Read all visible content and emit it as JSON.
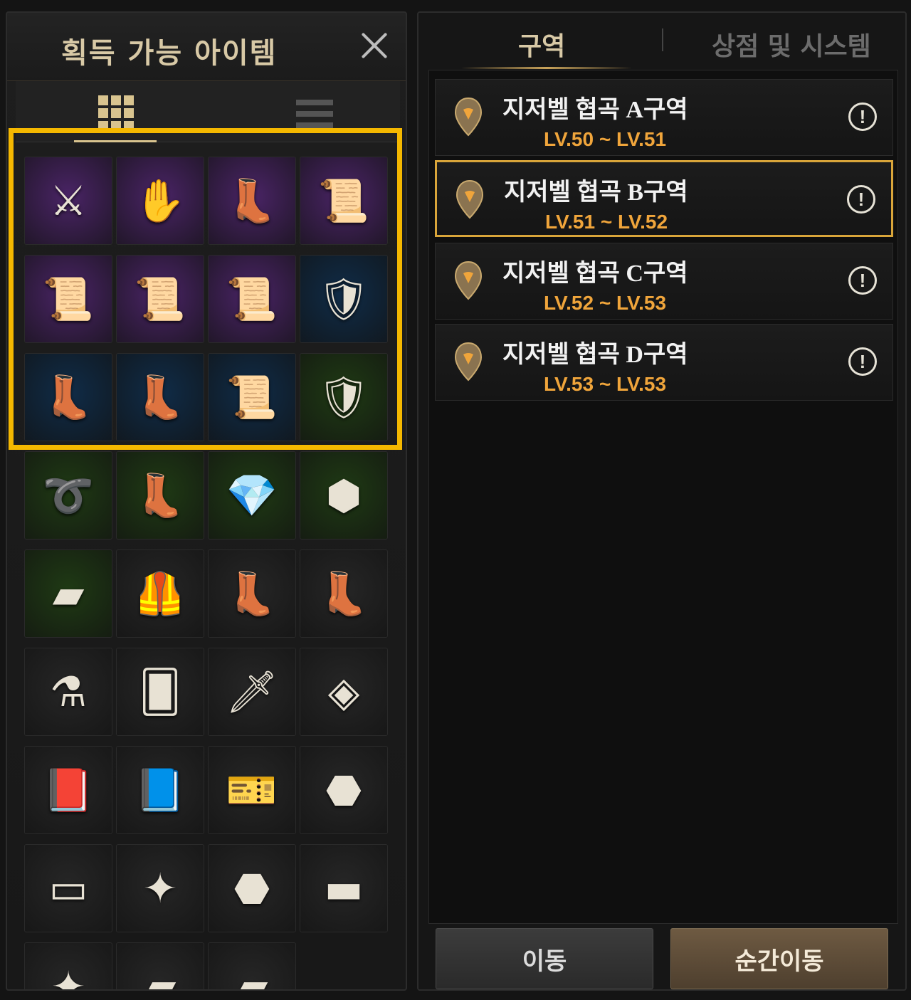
{
  "left_panel": {
    "title": "획득 가능 아이템",
    "close_icon": "close-icon",
    "view_modes": [
      "grid-view-icon",
      "list-view-icon"
    ],
    "items": [
      {
        "name": "crossbow",
        "glyph": "⚔",
        "bg": "#4a2466"
      },
      {
        "name": "leather-gloves",
        "glyph": "✋",
        "bg": "#4a2466"
      },
      {
        "name": "steel-boots",
        "glyph": "👢",
        "bg": "#4a2466"
      },
      {
        "name": "recipe-scroll",
        "glyph": "📜",
        "bg": "#4a2466"
      },
      {
        "name": "sword-blueprint",
        "glyph": "📜",
        "bg": "#4a2466"
      },
      {
        "name": "helmet-blueprint",
        "glyph": "📜",
        "bg": "#4a2466"
      },
      {
        "name": "necklace-blueprint",
        "glyph": "📜",
        "bg": "#4a2466"
      },
      {
        "name": "plate-armor",
        "glyph": "🛡",
        "bg": "#102c48"
      },
      {
        "name": "leather-boots",
        "glyph": "👢",
        "bg": "#102c48"
      },
      {
        "name": "blue-boots",
        "glyph": "👢",
        "bg": "#102c48"
      },
      {
        "name": "recipe-scroll-2",
        "glyph": "📜",
        "bg": "#102c48"
      },
      {
        "name": "dark-armor",
        "glyph": "🛡",
        "bg": "#1f3a14"
      },
      {
        "name": "belt",
        "glyph": "➰",
        "bg": "#1f3a14"
      },
      {
        "name": "metal-greaves",
        "glyph": "👢",
        "bg": "#1f3a14"
      },
      {
        "name": "crystal",
        "glyph": "💎",
        "bg": "#1f3a14"
      },
      {
        "name": "dice-stone",
        "glyph": "⬢",
        "bg": "#1f3a14"
      },
      {
        "name": "ingots",
        "glyph": "▰",
        "bg": "#1f3a14"
      },
      {
        "name": "leather-vest",
        "glyph": "🦺",
        "bg": "#262626"
      },
      {
        "name": "green-boots",
        "glyph": "👢",
        "bg": "#262626"
      },
      {
        "name": "brown-boots",
        "glyph": "👢",
        "bg": "#262626"
      },
      {
        "name": "red-potion",
        "glyph": "⚗",
        "bg": "#262626"
      },
      {
        "name": "tarot-card",
        "glyph": "🂠",
        "bg": "#262626"
      },
      {
        "name": "sword-rune",
        "glyph": "🗡",
        "bg": "#262626"
      },
      {
        "name": "necklace-rune",
        "glyph": "◈",
        "bg": "#262626"
      },
      {
        "name": "red-book",
        "glyph": "📕",
        "bg": "#262626"
      },
      {
        "name": "purple-book",
        "glyph": "📘",
        "bg": "#262626"
      },
      {
        "name": "ticket",
        "glyph": "🎫",
        "bg": "#262626"
      },
      {
        "name": "ore",
        "glyph": "⬣",
        "bg": "#262626"
      },
      {
        "name": "wood-log",
        "glyph": "▭",
        "bg": "#262626"
      },
      {
        "name": "silver-ore-chunk",
        "glyph": "✦",
        "bg": "#262626"
      },
      {
        "name": "iron-ore",
        "glyph": "⬣",
        "bg": "#262626"
      },
      {
        "name": "plank",
        "glyph": "▬",
        "bg": "#262626"
      },
      {
        "name": "green-ore",
        "glyph": "✦",
        "bg": "#262626"
      },
      {
        "name": "copper-ingot",
        "glyph": "▰",
        "bg": "#262626"
      },
      {
        "name": "silver-ingot",
        "glyph": "▰",
        "bg": "#262626"
      }
    ]
  },
  "right_panel": {
    "tabs": [
      {
        "label": "구역",
        "active": true
      },
      {
        "label": "상점 및 시스템",
        "active": false
      }
    ],
    "zones": [
      {
        "name": "지저벨 협곡 A구역",
        "level": "LV.50 ~ LV.51",
        "selected": false
      },
      {
        "name": "지저벨 협곡 B구역",
        "level": "LV.51 ~ LV.52",
        "selected": true
      },
      {
        "name": "지저벨 협곡 C구역",
        "level": "LV.52 ~ LV.53",
        "selected": false
      },
      {
        "name": "지저벨 협곡 D구역",
        "level": "LV.53 ~ LV.53",
        "selected": false
      }
    ],
    "info_icon_label": "!",
    "buttons": {
      "move": "이동",
      "teleport": "순간이동"
    }
  },
  "colors": {
    "highlight": "#f5b800",
    "level_text": "#f0a53b",
    "selected_border": "#d9a53a"
  }
}
